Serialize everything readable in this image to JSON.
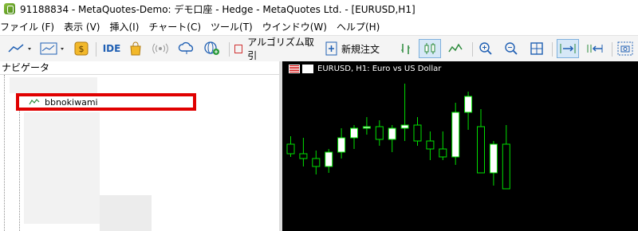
{
  "window": {
    "title": "91188834 - MetaQuotes-Demo: デモ口座 - Hedge - MetaQuotes Ltd. - [EURUSD,H1]"
  },
  "menu": {
    "items": [
      "ファイル (F)",
      "表示 (V)",
      "挿入(I)",
      "チャート(C)",
      "ツール(T)",
      "ウインドウ(W)",
      "ヘルプ(H)"
    ]
  },
  "toolbar": {
    "ide_label": "IDE",
    "algo_label": "アルゴリズム取引",
    "new_order_label": "新規注文"
  },
  "navigator": {
    "title": "ナビゲータ",
    "selected_item": "bbnokiwami"
  },
  "chart": {
    "title": "EURUSD, H1:  Euro vs US Dollar",
    "bull_color": "#ffffff",
    "bear_color": "#000000",
    "wick_color": "#00e000",
    "background": "#000000"
  },
  "chart_data": {
    "type": "candlestick",
    "symbol": "EURUSD",
    "timeframe": "H1",
    "candles": [
      {
        "open": 36,
        "high": 46,
        "low": 20,
        "close": 24
      },
      {
        "open": 24,
        "high": 44,
        "low": 8,
        "close": 18
      },
      {
        "open": 18,
        "high": 28,
        "low": -2,
        "close": 8
      },
      {
        "open": 8,
        "high": 30,
        "low": 0,
        "close": 26
      },
      {
        "open": 26,
        "high": 56,
        "low": 18,
        "close": 44
      },
      {
        "open": 44,
        "high": 60,
        "low": 30,
        "close": 56
      },
      {
        "open": 56,
        "high": 70,
        "low": 48,
        "close": 58
      },
      {
        "open": 58,
        "high": 66,
        "low": 34,
        "close": 42
      },
      {
        "open": 42,
        "high": 60,
        "low": 26,
        "close": 56
      },
      {
        "open": 56,
        "high": 112,
        "low": 40,
        "close": 60
      },
      {
        "open": 60,
        "high": 70,
        "low": 34,
        "close": 40
      },
      {
        "open": 40,
        "high": 52,
        "low": 16,
        "close": 30
      },
      {
        "open": 30,
        "high": 52,
        "low": 16,
        "close": 20
      },
      {
        "open": 20,
        "high": 88,
        "low": 10,
        "close": 76
      },
      {
        "open": 76,
        "high": 102,
        "low": 54,
        "close": 96
      },
      {
        "open": 58,
        "high": 80,
        "low": 6,
        "close": 0
      },
      {
        "open": 0,
        "high": 40,
        "low": -16,
        "close": 36
      },
      {
        "open": 36,
        "high": 60,
        "low": -20,
        "close": -20
      }
    ]
  }
}
